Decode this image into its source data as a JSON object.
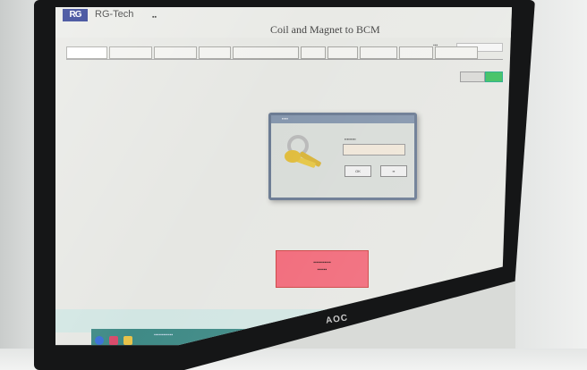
{
  "app": {
    "brand": "RG-Tech",
    "title": "Coil and Magnet to BCM"
  },
  "tabs": [
    {
      "label": "",
      "active": true
    },
    {
      "label": ""
    },
    {
      "label": ""
    },
    {
      "label": ""
    },
    {
      "label": ""
    },
    {
      "label": ""
    },
    {
      "label": ""
    },
    {
      "label": ""
    },
    {
      "label": ""
    },
    {
      "label": ""
    }
  ],
  "dialog": {
    "ok_label": "OK"
  },
  "monitor": {
    "brand": "AOC"
  },
  "colors": {
    "header_bg": "#e9eae6",
    "logo_blue": "#1c2d8a",
    "warning_red": "#f16a7a",
    "accent_green": "#3bbf5e",
    "taskbar": "#3f8a86"
  },
  "icons": [
    "keys-icon",
    "windows-start-icon",
    "browser-icon",
    "folder-icon"
  ]
}
